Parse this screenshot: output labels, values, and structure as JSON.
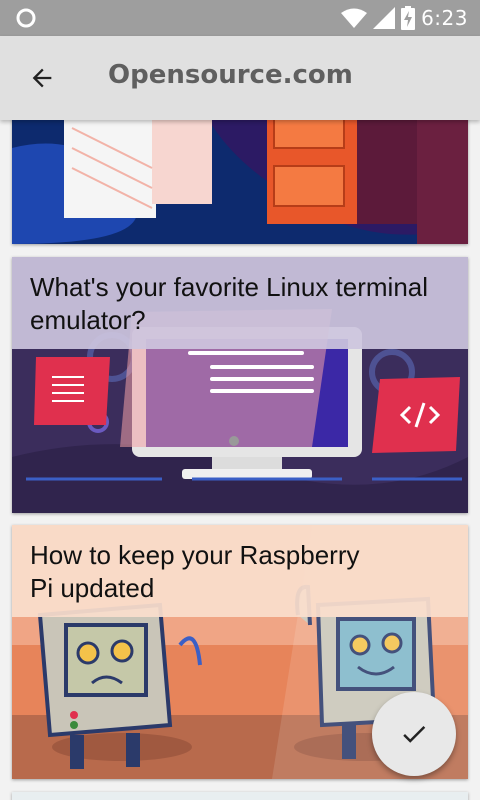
{
  "status_bar": {
    "time": "6:23",
    "icons": [
      "circle-notification-icon",
      "wifi-icon",
      "cell-signal-icon",
      "battery-charging-icon"
    ]
  },
  "app_bar": {
    "title": "Opensource.com",
    "back_icon": "arrow-back-icon"
  },
  "articles": [
    {
      "title": ""
    },
    {
      "title": "What's your favorite Linux terminal emulator?"
    },
    {
      "title": "How to keep your Raspberry Pi updated"
    }
  ],
  "fab": {
    "icon": "checkmark-icon"
  },
  "colors": {
    "status_bar": "#9e9e9e",
    "app_bar": "#e0e0e0",
    "background": "#f2f2f2",
    "card1_primary": "#0d2a6e",
    "card1_accent": "#e8572a",
    "card2_bg": "#3b2d5c",
    "card2_accent": "#e0304e",
    "card3_bg": "#e7845a"
  }
}
